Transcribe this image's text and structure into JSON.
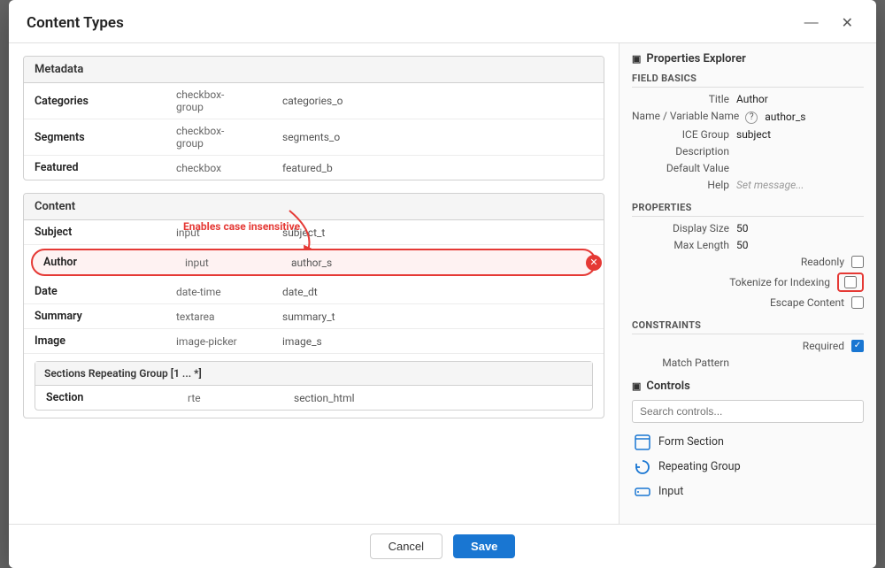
{
  "dialog": {
    "title": "Content Types",
    "minimize_label": "—",
    "close_label": "✕"
  },
  "left": {
    "sections": [
      {
        "name": "metadata-section",
        "header": "Metadata",
        "fields": [
          {
            "name": "Categories",
            "type": "checkbox-group",
            "var": "categories_o"
          },
          {
            "name": "Segments",
            "type": "checkbox-group",
            "var": "segments_o"
          },
          {
            "name": "Featured",
            "type": "checkbox",
            "var": "featured_b"
          }
        ]
      },
      {
        "name": "content-section",
        "header": "Content",
        "fields": [
          {
            "name": "Subject",
            "type": "input",
            "var": "subject_t",
            "highlighted": false
          },
          {
            "name": "Author",
            "type": "input",
            "var": "author_s",
            "highlighted": true
          },
          {
            "name": "Date",
            "type": "date-time",
            "var": "date_dt",
            "highlighted": false
          },
          {
            "name": "Summary",
            "type": "textarea",
            "var": "summary_t",
            "highlighted": false
          },
          {
            "name": "Image",
            "type": "image-picker",
            "var": "image_s",
            "highlighted": false
          }
        ],
        "subsection": {
          "header": "Sections Repeating Group [1 ... *]",
          "fields": [
            {
              "name": "Section",
              "type": "rte",
              "var": "section_html"
            }
          ]
        }
      }
    ],
    "annotation": "Enables case insensitive"
  },
  "right": {
    "explorer_title": "Properties Explorer",
    "field_basics_title": "Field Basics",
    "properties_title": "Properties",
    "constraints_title": "Constraints",
    "controls_title": "Controls",
    "fields": {
      "title_label": "Title",
      "title_value": "Author",
      "name_label": "Name / Variable Name",
      "name_value": "author_s",
      "ice_group_label": "ICE Group",
      "ice_group_value": "subject",
      "description_label": "Description",
      "description_value": "",
      "default_value_label": "Default Value",
      "default_value_value": "",
      "help_label": "Help",
      "help_value": "Set message..."
    },
    "properties": {
      "display_size_label": "Display Size",
      "display_size_value": "50",
      "max_length_label": "Max Length",
      "max_length_value": "50",
      "readonly_label": "Readonly",
      "tokenize_label": "Tokenize for Indexing",
      "escape_content_label": "Escape Content"
    },
    "constraints": {
      "required_label": "Required",
      "required_checked": true,
      "match_pattern_label": "Match Pattern"
    },
    "controls": {
      "search_placeholder": "Search controls...",
      "items": [
        {
          "icon": "form-section-icon",
          "label": "Form Section"
        },
        {
          "icon": "repeating-group-icon",
          "label": "Repeating Group"
        },
        {
          "icon": "input-icon",
          "label": "Input"
        }
      ]
    }
  },
  "footer": {
    "cancel_label": "Cancel",
    "save_label": "Save"
  }
}
